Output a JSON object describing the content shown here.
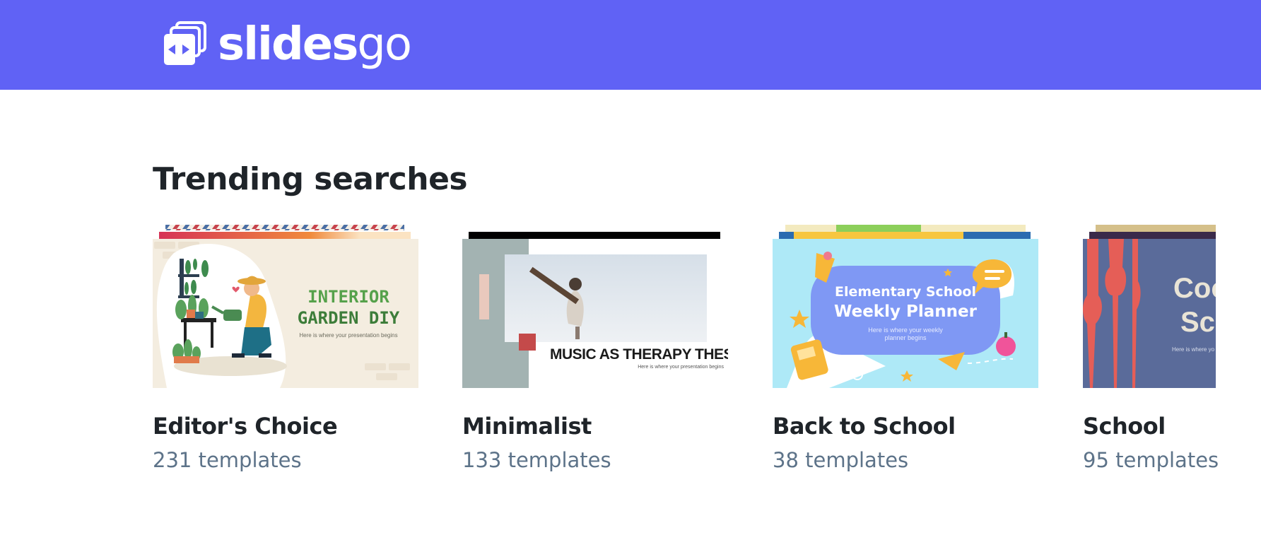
{
  "header": {
    "logo_bold": "slides",
    "logo_light": "go",
    "background": "#6062f5"
  },
  "trending": {
    "title": "Trending searches",
    "cards": [
      {
        "name": "Editor's Choice",
        "count": "231 templates",
        "thumb_title_line1": "INTERIOR",
        "thumb_title_line2": "GARDEN DIY",
        "thumb_subtitle": "Here is where your presentation begins"
      },
      {
        "name": "Minimalist",
        "count": "133 templates",
        "thumb_title": "MUSIC AS THERAPY THESIS",
        "thumb_subtitle": "Here is where your presentation begins"
      },
      {
        "name": "Back to School",
        "count": "38 templates",
        "thumb_title_line1": "Elementary School",
        "thumb_title_line2": "Weekly Planner",
        "thumb_subtitle_line1": "Here is where your weekly",
        "thumb_subtitle_line2": "planner begins"
      },
      {
        "name": "School",
        "count": "95 templates",
        "thumb_title_line1": "Cool",
        "thumb_title_line2": "Sch",
        "thumb_subtitle": "Here is where yo"
      }
    ]
  },
  "colors": {
    "title_text": "#1f2429",
    "count_text": "#5d7389"
  }
}
